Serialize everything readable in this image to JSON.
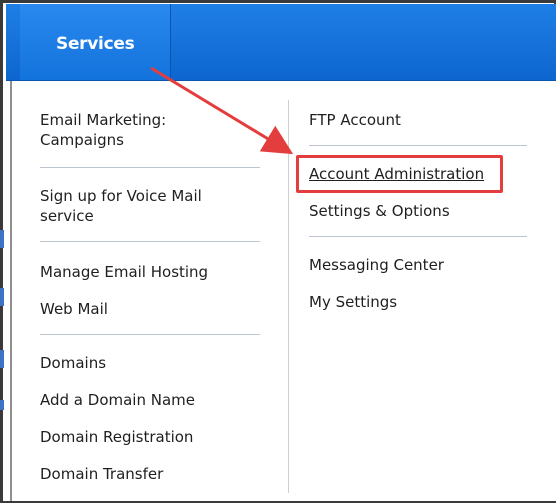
{
  "nav": {
    "services_label": "Services"
  },
  "left_column": {
    "items": [
      "Email Marketing:\nCampaigns",
      "Sign up for Voice Mail\nservice",
      "Manage Email Hosting",
      "Web Mail",
      "Domains",
      "Add a Domain Name",
      "Domain Registration",
      "Domain Transfer"
    ]
  },
  "right_column": {
    "items": [
      "FTP Account",
      "Account Administration",
      "Settings & Options",
      "Messaging Center",
      "My Settings"
    ]
  },
  "annotation": {
    "arrow_color": "#e43d3d",
    "highlight_color": "#e43d3d"
  },
  "colors": {
    "nav_blue": "#1373dc",
    "text": "#1f1f1f"
  }
}
